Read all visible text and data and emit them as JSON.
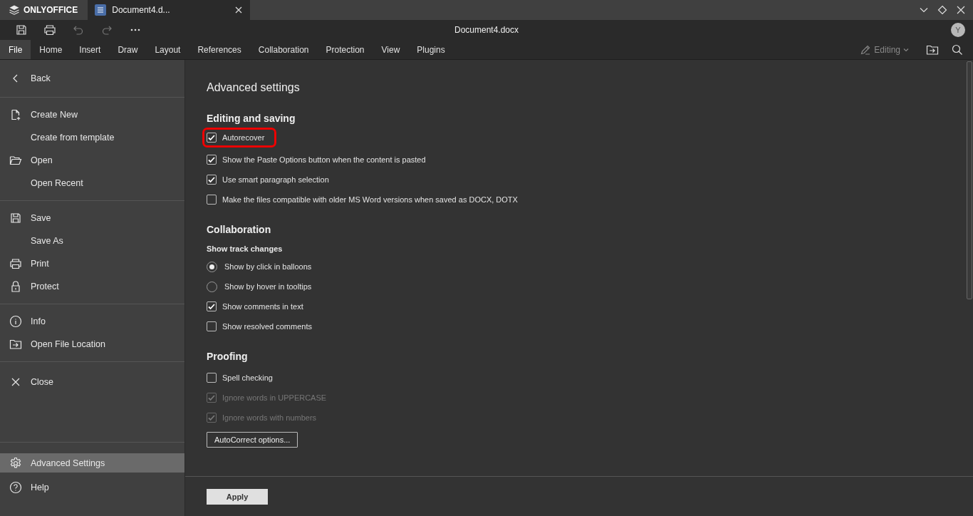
{
  "app": {
    "logo": "ONLYOFFICE"
  },
  "doc_tab": {
    "title": "Document4.d..."
  },
  "quick_access": [
    {
      "kind": "save",
      "disabled": false
    },
    {
      "kind": "print",
      "disabled": false
    },
    {
      "kind": "undo",
      "disabled": true
    },
    {
      "kind": "redo",
      "disabled": true
    },
    {
      "kind": "more",
      "disabled": false
    }
  ],
  "document_title": "Document4.docx",
  "user": {
    "initial": "Y"
  },
  "menu_tabs": [
    {
      "label": "File",
      "selected": true
    },
    {
      "label": "Home",
      "selected": false
    },
    {
      "label": "Insert",
      "selected": false
    },
    {
      "label": "Draw",
      "selected": false
    },
    {
      "label": "Layout",
      "selected": false
    },
    {
      "label": "References",
      "selected": false
    },
    {
      "label": "Collaboration",
      "selected": false
    },
    {
      "label": "Protection",
      "selected": false
    },
    {
      "label": "View",
      "selected": false
    },
    {
      "label": "Plugins",
      "selected": false
    }
  ],
  "mode_button": {
    "label": "Editing"
  },
  "sidebar": {
    "groups": [
      [
        {
          "label": "Back",
          "selected": false
        }
      ],
      [
        {
          "label": "Create New",
          "selected": false
        },
        {
          "label": "Create from template",
          "selected": false
        },
        {
          "label": "Open",
          "selected": false
        },
        {
          "label": "Open Recent",
          "selected": false
        }
      ],
      [
        {
          "label": "Save",
          "selected": false
        },
        {
          "label": "Save As",
          "selected": false
        },
        {
          "label": "Print",
          "selected": false
        },
        {
          "label": "Protect",
          "selected": false
        }
      ],
      [
        {
          "label": "Info",
          "selected": false
        },
        {
          "label": "Open File Location",
          "selected": false
        }
      ],
      [
        {
          "label": "Close",
          "selected": false
        }
      ],
      [
        {
          "label": "Advanced Settings",
          "selected": true
        },
        {
          "label": "Help",
          "selected": false
        }
      ]
    ]
  },
  "settings": {
    "title": "Advanced settings",
    "sections": [
      {
        "heading": "Editing and saving",
        "items": [
          {
            "kind": "checkbox",
            "label": "Autorecover",
            "checked": true,
            "disabled": false,
            "highlighted": true
          },
          {
            "kind": "checkbox",
            "label": "Show the Paste Options button when the content is pasted",
            "checked": true,
            "disabled": false,
            "highlighted": false
          },
          {
            "kind": "checkbox",
            "label": "Use smart paragraph selection",
            "checked": true,
            "disabled": false,
            "highlighted": false
          },
          {
            "kind": "checkbox",
            "label": "Make the files compatible with older MS Word versions when saved as DOCX, DOTX",
            "checked": false,
            "disabled": false,
            "highlighted": false
          }
        ]
      },
      {
        "heading": "Collaboration",
        "items": [
          {
            "kind": "subheading",
            "label": "Show track changes"
          },
          {
            "kind": "radio",
            "label": "Show by click in balloons",
            "selected": true
          },
          {
            "kind": "radio",
            "label": "Show by hover in tooltips",
            "selected": false
          },
          {
            "kind": "checkbox",
            "label": "Show comments in text",
            "checked": true,
            "disabled": false,
            "highlighted": false
          },
          {
            "kind": "checkbox",
            "label": "Show resolved comments",
            "checked": false,
            "disabled": false,
            "highlighted": false
          }
        ]
      },
      {
        "heading": "Proofing",
        "items": [
          {
            "kind": "checkbox",
            "label": "Spell checking",
            "checked": false,
            "disabled": false,
            "highlighted": false
          },
          {
            "kind": "checkbox",
            "label": "Ignore words in UPPERCASE",
            "checked": true,
            "disabled": true,
            "highlighted": false
          },
          {
            "kind": "checkbox",
            "label": "Ignore words with numbers",
            "checked": true,
            "disabled": true,
            "highlighted": false
          },
          {
            "kind": "button",
            "label": "AutoCorrect options..."
          }
        ]
      }
    ],
    "apply_button": {
      "label": "Apply"
    }
  }
}
